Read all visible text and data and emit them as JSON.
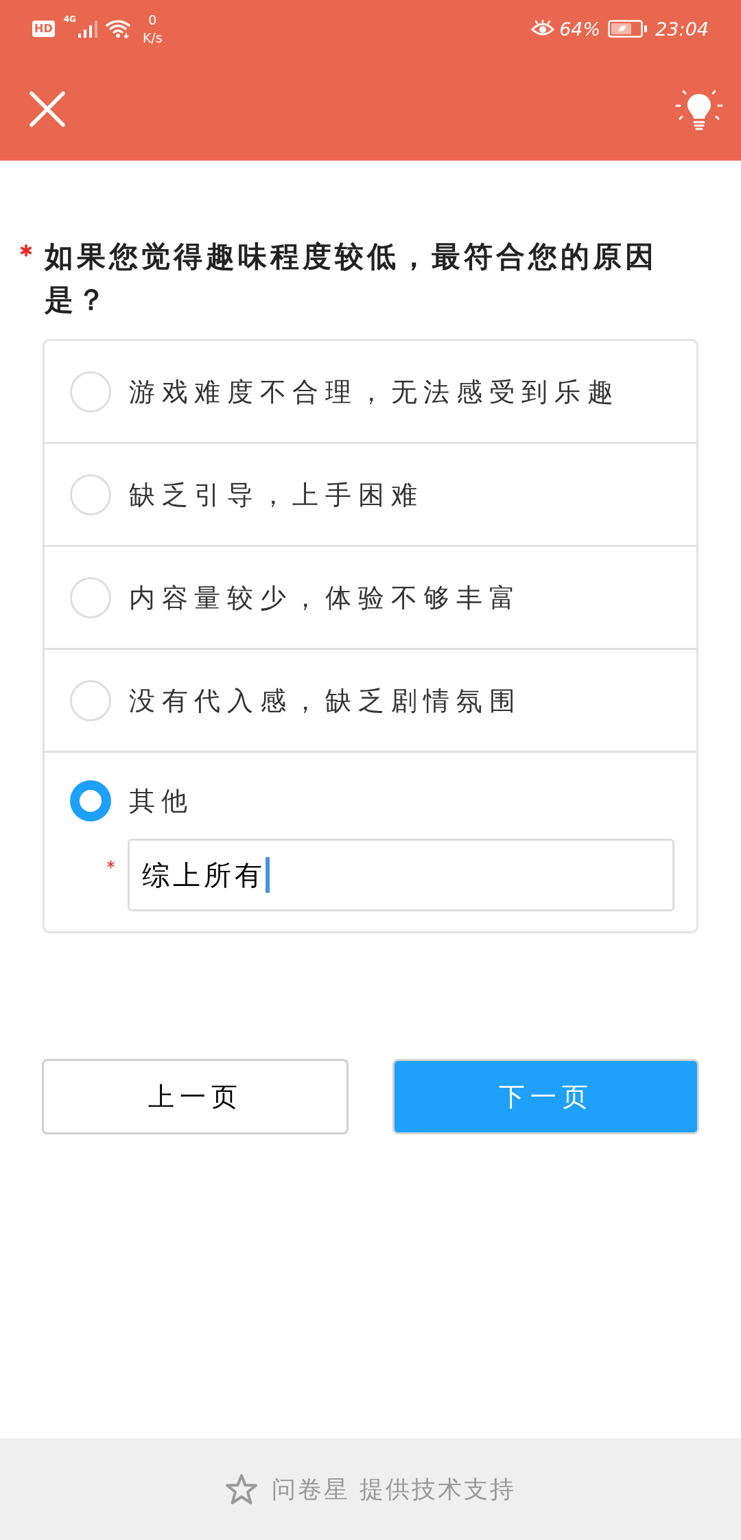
{
  "status_bar": {
    "hd_badge": "HD",
    "network_type": "4G",
    "speed_value": "0",
    "speed_unit": "K/s",
    "battery_percent": "64%",
    "time": "23:04"
  },
  "question": {
    "required": true,
    "title": "如果您觉得趣味程度较低，最符合您的原因是？"
  },
  "options": [
    {
      "label": "游戏难度不合理，无法感受到乐趣",
      "selected": false
    },
    {
      "label": "缺乏引导，上手困难",
      "selected": false
    },
    {
      "label": "内容量较少，体验不够丰富",
      "selected": false
    },
    {
      "label": "没有代入感，缺乏剧情氛围",
      "selected": false
    },
    {
      "label": "其他",
      "selected": true,
      "other_input": {
        "required": true,
        "value": "综上所有",
        "focused": true
      }
    }
  ],
  "buttons": [
    {
      "label": "上一页",
      "kind": "secondary"
    },
    {
      "label": "下一页",
      "kind": "primary"
    }
  ],
  "footer": {
    "text": "问卷星 提供技术支持"
  }
}
